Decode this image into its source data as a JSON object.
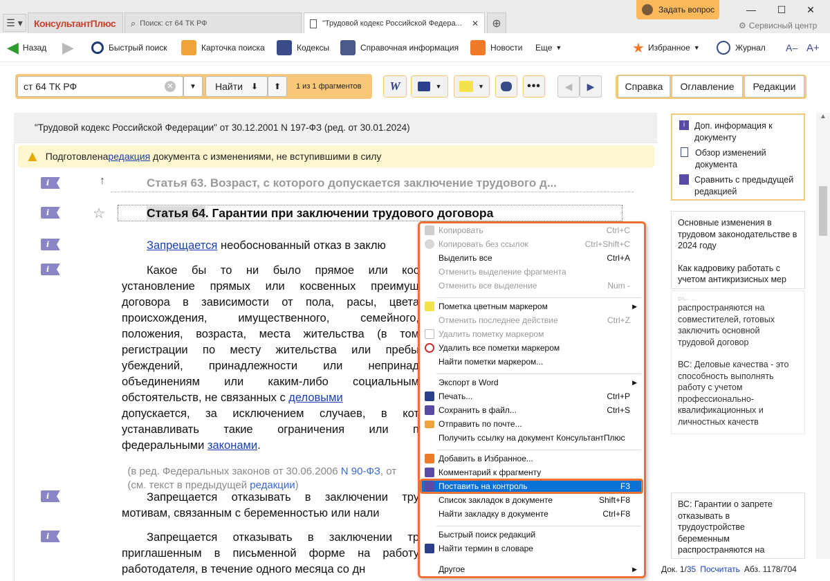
{
  "tabs": {
    "logo": "КонсультантПлюс",
    "search_tab": "Поиск: ст 64 ТК РФ",
    "doc_tab": "\"Трудовой кодекс Российской Федера..."
  },
  "window": {
    "ask_button": "Задать вопрос",
    "service_center": "Сервисный центр"
  },
  "toolbar": {
    "back": "Назад",
    "quick_search": "Быстрый поиск",
    "search_card": "Карточка поиска",
    "codes": "Кодексы",
    "reference": "Справочная информация",
    "news": "Новости",
    "more": "Еще",
    "favorites": "Избранное",
    "journal": "Журнал",
    "font_minus": "A–",
    "font_plus": "A+"
  },
  "search": {
    "query": "ст 64 ТК РФ",
    "find_button": "Найти",
    "fragments": "1 из 1 фрагментов"
  },
  "right_tabs": {
    "help": "Справка",
    "contents": "Оглавление",
    "editions": "Редакции"
  },
  "document": {
    "header": "\"Трудовой кодекс Российской Федерации\" от 30.12.2001 N 197-ФЗ (ред. от 30.01.2024)",
    "warning_pre": "Подготовлена ",
    "warning_link": "редакция",
    "warning_post": " документа с изменениями, не вступившими в силу",
    "prev_article": "Статья 63. Возраст, с которого допускается заключение трудового д...",
    "article_title_hl": "Статья 64",
    "article_title_rest": ". Гарантии при заключении трудового договора",
    "p1_link": "Запрещается",
    "p1_rest": " необоснованный отказ в заклю",
    "p2": [
      "Какое бы то ни было прямое или кос",
      "установление прямых или косвенных преимущ",
      "договора в зависимости от пола, расы, цвета",
      "происхождения, имущественного, семейного,",
      "положения, возраста, места жительства (в том",
      "регистрации по месту жительства или пребы",
      "убеждений, принадлежности или непринад",
      "объединениям или каким-либо социальным",
      "обстоятельств, не связанных с ",
      "допускается, за исключением случаев, в кот",
      "устанавливать такие ограничения или п",
      "федеральными "
    ],
    "p2_link1": "деловыми",
    "p2_link2": "законами",
    "amend1_pre": "(в ред. Федеральных законов от 30.06.2006 ",
    "amend1_link": "N 90-ФЗ",
    "amend1_post": ", от",
    "amend2_pre": "(см. текст в предыдущей ",
    "amend2_link": "редакции",
    "amend2_post": ")",
    "p3": [
      "Запрещается отказывать в заключении тру",
      "мотивам, связанным с беременностью или нали"
    ],
    "p4": [
      "Запрещается отказывать в заключении тр",
      "приглашенным в письменной форме на работу",
      "работодателя, в течение одного месяца со дн"
    ]
  },
  "info_card": {
    "item1": "Доп. информация к документу",
    "item2": "Обзор изменений документа",
    "item3": "Сравнить с предыдущей редакцией"
  },
  "news_card": {
    "text1": "Основные изменения в трудовом законодательстве в 2024 году",
    "text2": "Как кадровику работать с учетом антикризисных мер"
  },
  "faded_card": {
    "text1_fragment": "ВС: ...",
    "text1": "распространяются на совместителей, готовых заключить основной трудовой договор",
    "text2": "ВС: Деловые качества - это способность выполнять работу с учетом профессионально-квалификационных и личностных качеств"
  },
  "bottom_card": {
    "text": "ВС: Гарантии о запрете отказывать в трудоустройстве беременным распространяются на"
  },
  "status": {
    "doc": "Док. 1/",
    "doc_total": "35",
    "count_link": "Посчитать",
    "abs": "Абз. 1178/704"
  },
  "context_menu": {
    "items": [
      {
        "label": "Копировать",
        "shortcut": "Ctrl+C",
        "disabled": true
      },
      {
        "label": "Копировать без ссылок",
        "shortcut": "Ctrl+Shift+C",
        "disabled": true
      },
      {
        "label": "Выделить все",
        "shortcut": "Ctrl+A",
        "disabled": false
      },
      {
        "label": "Отменить выделение фрагмента",
        "shortcut": "",
        "disabled": true
      },
      {
        "label": "Отменить все выделение",
        "shortcut": "Num -",
        "disabled": true
      },
      {
        "label": "Пометка цветным маркером",
        "shortcut": "",
        "disabled": false
      },
      {
        "label": "Отменить последнее действие",
        "shortcut": "Ctrl+Z",
        "disabled": true
      },
      {
        "label": "Удалить пометку маркером",
        "shortcut": "",
        "disabled": true
      },
      {
        "label": "Удалить все пометки маркером",
        "shortcut": "",
        "disabled": false
      },
      {
        "label": "Найти пометки маркером...",
        "shortcut": "",
        "disabled": false
      },
      {
        "label": "Экспорт в Word",
        "shortcut": "",
        "disabled": false
      },
      {
        "label": "Печать...",
        "shortcut": "Ctrl+P",
        "disabled": false
      },
      {
        "label": "Сохранить в файл...",
        "shortcut": "Ctrl+S",
        "disabled": false
      },
      {
        "label": "Отправить по почте...",
        "shortcut": "",
        "disabled": false
      },
      {
        "label": "Получить ссылку на документ КонсультантПлюс",
        "shortcut": "",
        "disabled": false
      },
      {
        "label": "Добавить в Избранное...",
        "shortcut": "",
        "disabled": false
      },
      {
        "label": "Комментарий к фрагменту",
        "shortcut": "",
        "disabled": false
      },
      {
        "label": "Поставить на контроль",
        "shortcut": "F3",
        "disabled": false
      },
      {
        "label": "Список закладок в документе",
        "shortcut": "Shift+F8",
        "disabled": false
      },
      {
        "label": "Найти закладку в документе",
        "shortcut": "Ctrl+F8",
        "disabled": false
      },
      {
        "label": "Быстрый поиск редакций",
        "shortcut": "",
        "disabled": false
      },
      {
        "label": "Найти термин в словаре",
        "shortcut": "",
        "disabled": false
      },
      {
        "label": "Другое",
        "shortcut": "",
        "disabled": false
      }
    ]
  },
  "colors": {
    "accent_orange": "#f07030",
    "link_blue": "#1a3fb6",
    "highlight_blue": "#0a72d6",
    "warning_bg": "#fdf6cf",
    "info_purple": "#8a86c6"
  }
}
